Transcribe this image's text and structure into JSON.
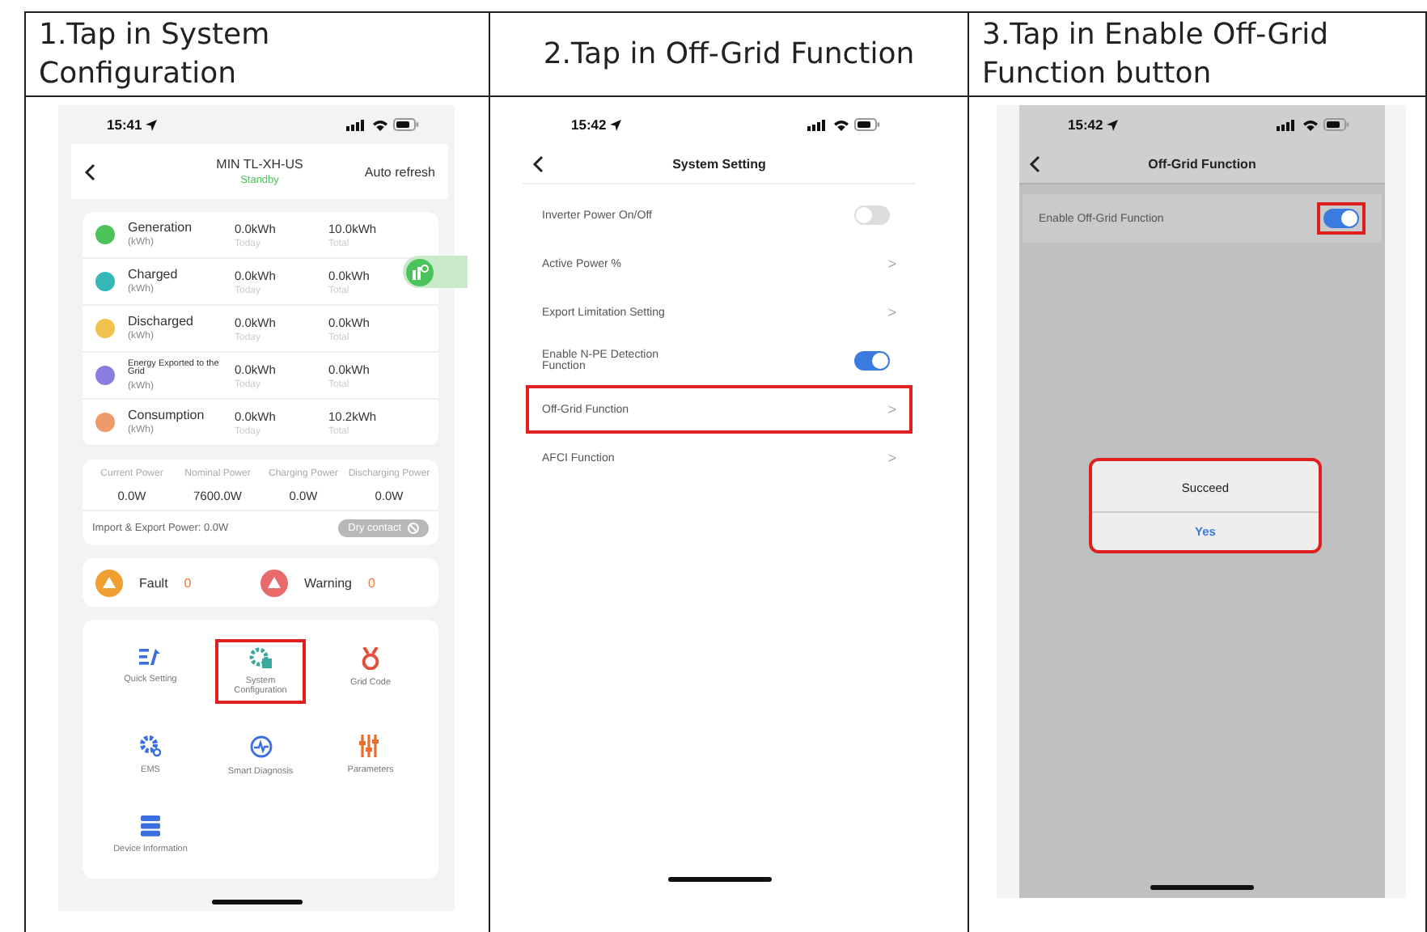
{
  "steps": [
    {
      "heading": "1.Tap in System Configuration",
      "screen": {
        "kind": "home",
        "time": "15:41",
        "title": "MIN TL-XH-US",
        "status": "Standby",
        "action": "Auto refresh",
        "energy": [
          {
            "label": "Generation",
            "unit": "(kWh)",
            "today": "0.0kWh",
            "today_label": "Today",
            "total": "10.0kWh",
            "total_label": "Total",
            "color": "#4cc35a"
          },
          {
            "label": "Charged",
            "unit": "(kWh)",
            "today": "0.0kWh",
            "today_label": "Today",
            "total": "0.0kWh",
            "total_label": "Total",
            "color": "#36b8b8"
          },
          {
            "label": "Discharged",
            "unit": "(kWh)",
            "today": "0.0kWh",
            "today_label": "Today",
            "total": "0.0kWh",
            "total_label": "Total",
            "color": "#f2c14e"
          },
          {
            "label": "Energy Exported to the Grid",
            "unit": "(kWh)",
            "today": "0.0kWh",
            "today_label": "Today",
            "total": "0.0kWh",
            "total_label": "Total",
            "color": "#8a7de0"
          },
          {
            "label": "Consumption",
            "unit": "(kWh)",
            "today": "0.0kWh",
            "today_label": "Today",
            "total": "10.2kWh",
            "total_label": "Total",
            "color": "#ef9a6a"
          }
        ],
        "power": [
          {
            "label": "Current Power",
            "value": "0.0W"
          },
          {
            "label": "Nominal Power",
            "value": "7600.0W"
          },
          {
            "label": "Charging Power",
            "value": "0.0W"
          },
          {
            "label": "Discharging Power",
            "value": "0.0W"
          }
        ],
        "import_export": "Import & Export Power: 0.0W",
        "dry_contact": {
          "label": "Dry contact",
          "disabled": true
        },
        "alerts": [
          {
            "label": "Fault",
            "count": "0",
            "color": "#f0a030"
          },
          {
            "label": "Warning",
            "count": "0",
            "color": "#e86a6a"
          }
        ],
        "functions": [
          {
            "label": "Quick Setting",
            "kind": "quick",
            "highlighted": false
          },
          {
            "label": "System Configuration",
            "kind": "config",
            "highlighted": true
          },
          {
            "label": "Grid Code",
            "kind": "grid",
            "highlighted": false
          },
          {
            "label": "EMS",
            "kind": "ems",
            "highlighted": false
          },
          {
            "label": "Smart Diagnosis",
            "kind": "diagnosis",
            "highlighted": false
          },
          {
            "label": "Parameters",
            "kind": "parameters",
            "highlighted": false
          },
          {
            "label": "Device Information",
            "kind": "info",
            "highlighted": false
          }
        ]
      }
    },
    {
      "heading": "2.Tap in Off-Grid Function",
      "screen": {
        "kind": "settings",
        "time": "15:42",
        "title": "System Setting",
        "rows": [
          {
            "label": "Inverter Power On/Off",
            "kind": "toggle",
            "on": false,
            "highlighted": false
          },
          {
            "label": "Active Power %",
            "kind": "link",
            "arrow": ">",
            "highlighted": false
          },
          {
            "label": "Export Limitation Setting",
            "kind": "link",
            "arrow": ">",
            "highlighted": false
          },
          {
            "label": "Enable N-PE Detection Function",
            "kind": "toggle",
            "on": true,
            "highlighted": false
          },
          {
            "label": "Off-Grid Function",
            "kind": "link",
            "arrow": ">",
            "highlighted": true
          },
          {
            "label": "AFCI Function",
            "kind": "link",
            "arrow": ">",
            "highlighted": false
          }
        ]
      }
    },
    {
      "heading": "3.Tap in Enable Off-Grid Function button",
      "screen": {
        "kind": "settings",
        "time": "15:42",
        "title": "Off-Grid Function",
        "rows": [
          {
            "label": "Enable Off-Grid Function",
            "kind": "toggle",
            "on": true,
            "highlighted": false,
            "toggle_highlighted": true
          }
        ],
        "dialog": {
          "message": "Succeed",
          "button": "Yes",
          "highlighted": true
        }
      }
    }
  ]
}
